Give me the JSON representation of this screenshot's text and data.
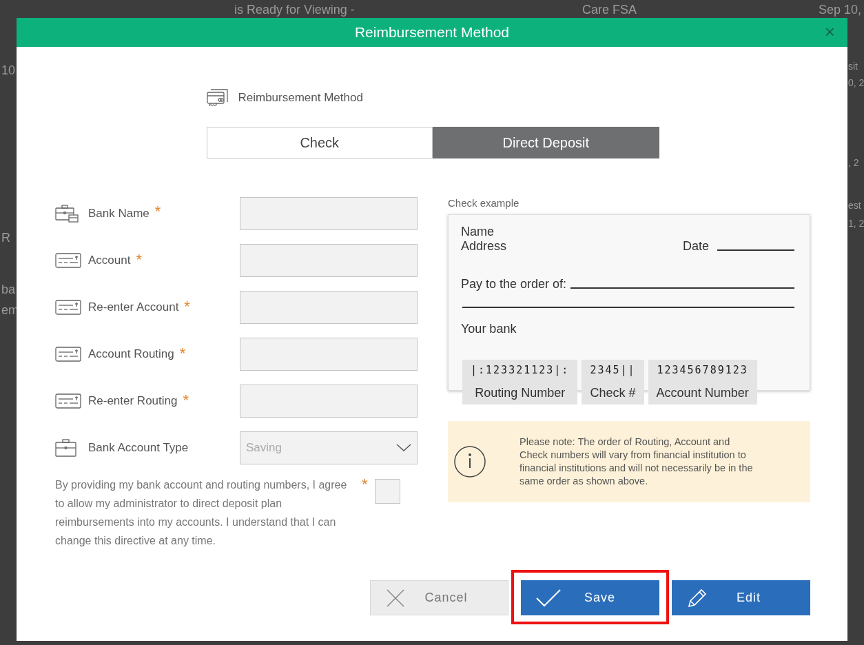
{
  "background": {
    "top_fragments": [
      "is Ready for Viewing -",
      "Care FSA",
      "Sep 10,"
    ],
    "left_fragments": [
      "10",
      "R",
      "ba",
      "em"
    ],
    "right_fragments": [
      "sit",
      "0, 2",
      ", 2",
      "est",
      "1, 2"
    ]
  },
  "dialog": {
    "title": "Reimbursement Method",
    "close": "×"
  },
  "section_title": "Reimbursement Method",
  "tabs": [
    {
      "label": "Check",
      "selected": false
    },
    {
      "label": "Direct Deposit",
      "selected": true
    }
  ],
  "fields": [
    {
      "kind": "text",
      "label": "Bank Name",
      "asterisk": "*"
    },
    {
      "kind": "text",
      "label": "Account",
      "asterisk": "*"
    },
    {
      "kind": "text",
      "label": "Re-enter Account",
      "asterisk": "*"
    },
    {
      "kind": "text",
      "label": "Account Routing",
      "asterisk": "*"
    },
    {
      "kind": "text",
      "label": "Re-enter Routing",
      "asterisk": "*"
    },
    {
      "kind": "select",
      "label": "Bank Account Type",
      "placeholder": "Saving"
    }
  ],
  "consent": {
    "text": "By providing my bank account and routing numbers, I agree to allow my administrator to direct deposit plan reimbursements into my accounts. I understand that I can change this directive at any time.",
    "asterisk": "*",
    "checked": false
  },
  "check_example": {
    "label": "Check example",
    "name": "Name",
    "address": "Address",
    "date": "Date",
    "pay_to": "Pay to the order of:",
    "bank": "Your bank",
    "numbers": [
      {
        "digits": "|:123321123|:",
        "caption": "Routing Number"
      },
      {
        "digits": "2345||",
        "caption": "Check #"
      },
      {
        "digits": "123456789123",
        "caption": "Account Number"
      }
    ]
  },
  "note": "Please note: The order of Routing, Account and Check numbers will vary from financial institution to financial institutions and will not necessarily be in the same order as shown above.",
  "buttons": [
    {
      "kind": "cancel",
      "label": "Cancel"
    },
    {
      "kind": "save",
      "label": "Save",
      "highlighted": true
    },
    {
      "kind": "edit",
      "label": "Edit"
    }
  ]
}
